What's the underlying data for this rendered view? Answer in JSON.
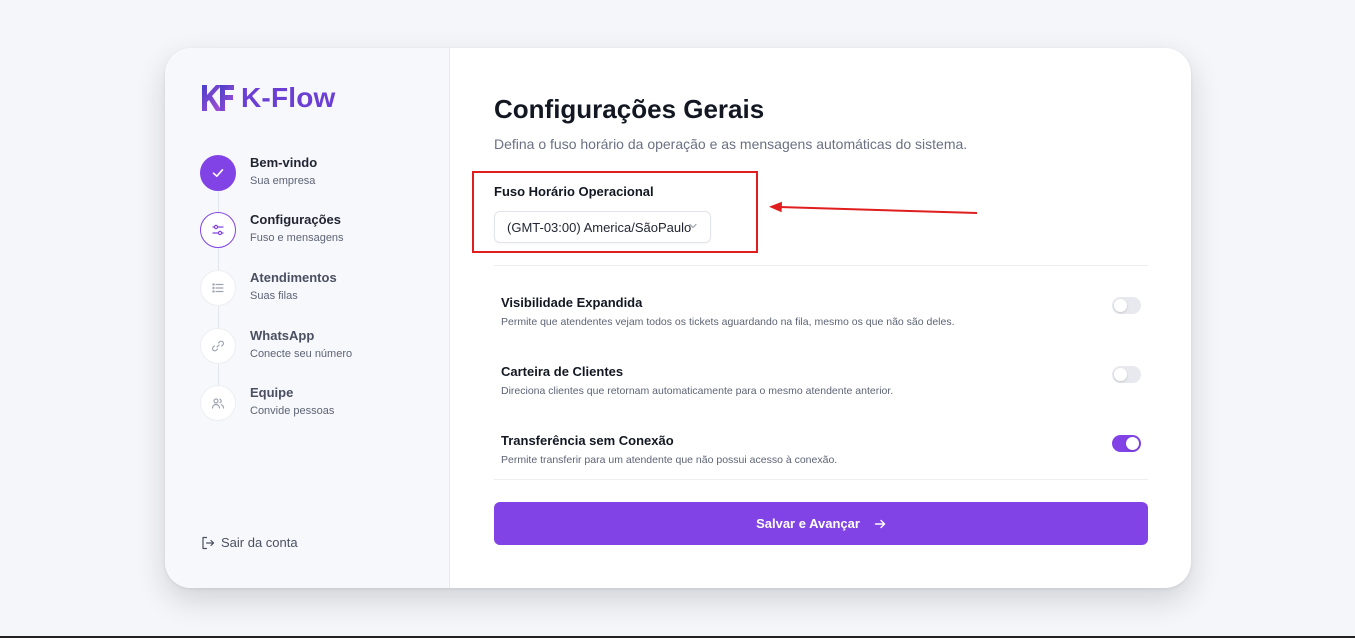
{
  "brand": {
    "name": "K-Flow",
    "color_from": "#4a3fc9",
    "color_to": "#a94fd6"
  },
  "steps": [
    {
      "title": "Bem-vindo",
      "subtitle": "Sua empresa",
      "state": "done",
      "icon": "check-icon"
    },
    {
      "title": "Configurações",
      "subtitle": "Fuso e mensagens",
      "state": "active",
      "icon": "sliders-icon"
    },
    {
      "title": "Atendimentos",
      "subtitle": "Suas filas",
      "state": "pending",
      "icon": "list-icon"
    },
    {
      "title": "WhatsApp",
      "subtitle": "Conecte seu número",
      "state": "pending",
      "icon": "link-icon"
    },
    {
      "title": "Equipe",
      "subtitle": "Convide pessoas",
      "state": "pending",
      "icon": "users-icon"
    }
  ],
  "logout": {
    "label": "Sair da conta",
    "icon": "logout-icon"
  },
  "main": {
    "title": "Configurações Gerais",
    "subtitle": "Defina o fuso horário da operação e as mensagens automáticas do sistema.",
    "timezone": {
      "label": "Fuso Horário Operacional",
      "value": "(GMT-03:00) America/SãoPaulo"
    },
    "options": [
      {
        "title": "Visibilidade Expandida",
        "description": "Permite que atendentes vejam todos os tickets aguardando na fila, mesmo os que não são deles.",
        "enabled": false
      },
      {
        "title": "Carteira de Clientes",
        "description": "Direciona clientes que retornam automaticamente para o mesmo atendente anterior.",
        "enabled": false
      },
      {
        "title": "Transferência sem Conexão",
        "description": "Permite transferir para um atendente que não possui acesso à conexão.",
        "enabled": true
      }
    ],
    "save_label": "Salvar e Avançar"
  },
  "colors": {
    "accent": "#8243e6",
    "annotation": "#e01e1e"
  }
}
